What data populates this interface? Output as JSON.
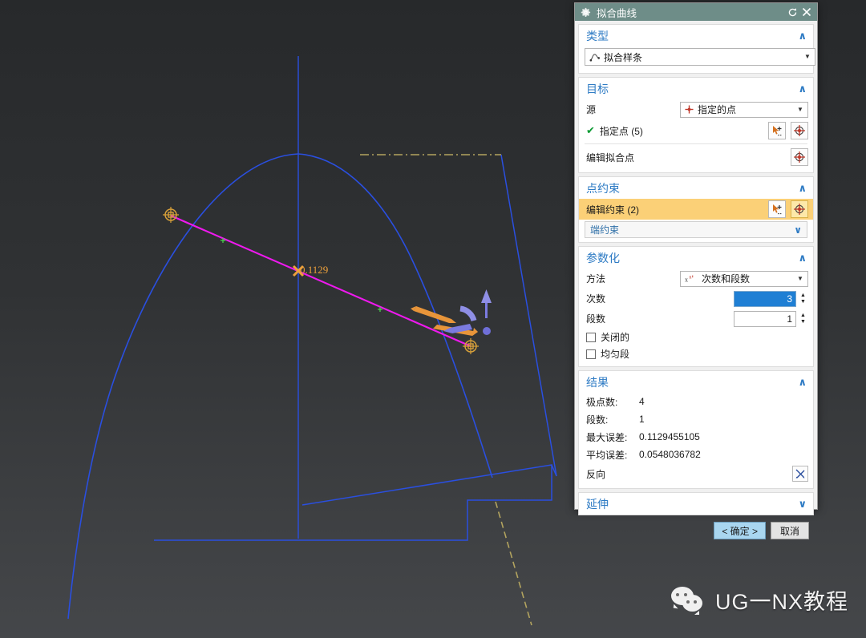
{
  "dialog": {
    "title": "拟合曲线",
    "icons": {
      "gear": "gear-icon",
      "reset": "reset-icon",
      "close": "close-icon"
    }
  },
  "type_section": {
    "header": "类型",
    "chevron": "∧",
    "value": "拟合样条",
    "icon": "spline-icon"
  },
  "target_section": {
    "header": "目标",
    "chevron": "∧",
    "source_label": "源",
    "source_value": "指定的点",
    "source_icon": "point-icon",
    "specify_points_label": "指定点 (5)",
    "check": "✔",
    "edit_fit_points_label": "编辑拟合点",
    "select_icon": "select-point-icon",
    "point_dialog_icon": "point-constructor-icon"
  },
  "point_constraint_section": {
    "header": "点约束",
    "chevron": "∧",
    "edit_constraint_label": "编辑约束 (2)",
    "end_constraint_label": "端约束",
    "end_constraint_chevron": "∨",
    "select_icon": "select-point-icon",
    "point_dialog_icon": "point-constructor-icon"
  },
  "parameterization_section": {
    "header": "参数化",
    "chevron": "∧",
    "method_label": "方法",
    "method_value": "次数和段数",
    "method_icon": "degree-segments-icon",
    "degree_label": "次数",
    "degree_value": "3",
    "segments_label": "段数",
    "segments_value": "1",
    "closed_label": "关闭的",
    "uniform_label": "均匀段",
    "closed_checked": false,
    "uniform_checked": false
  },
  "result_section": {
    "header": "结果",
    "chevron": "∧",
    "rows": [
      {
        "key": "极点数:",
        "value": "4"
      },
      {
        "key": "段数:",
        "value": "1"
      },
      {
        "key": "最大误差:",
        "value": "0.1129455105"
      },
      {
        "key": "平均误差:",
        "value": "0.0548036782"
      }
    ],
    "reverse_label": "反向",
    "reverse_icon": "reverse-direction-icon"
  },
  "extend_section": {
    "header": "延伸",
    "chevron": "∨"
  },
  "footer": {
    "ok_label": "< 确定 >",
    "cancel_label": "取消"
  },
  "viewport": {
    "error_label": "0.1129",
    "colors": {
      "curve_blue": "#2a4fe0",
      "fit_magenta": "#ee19ee",
      "point_marker": "#d8a13a",
      "handle_orange": "#e8953a",
      "handle_purple": "#7b7be0",
      "dashed_tan": "#b3a45f"
    }
  },
  "watermark": {
    "text": "UG一NX教程",
    "icon": "wechat-icon"
  }
}
